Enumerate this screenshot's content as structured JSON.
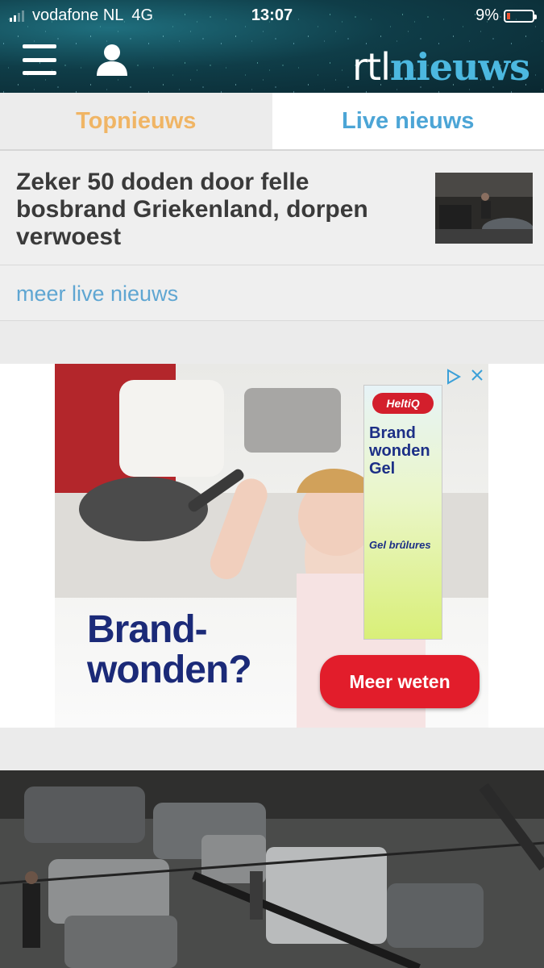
{
  "status_bar": {
    "carrier": "vodafone NL",
    "network": "4G",
    "time": "13:07",
    "battery": "9%"
  },
  "header": {
    "logo_part1": "rtl",
    "logo_part2": "nieuws"
  },
  "tabs": [
    {
      "label": "Topnieuws",
      "color": "#f0b565",
      "active": false
    },
    {
      "label": "Live nieuws",
      "color": "#4ca5d6",
      "active": true
    }
  ],
  "live_article": {
    "title": "Zeker 50 doden door felle bosbrand Griekenland, dorpen verwoest"
  },
  "more_link": "meer live nieuws",
  "ad": {
    "headline_line1": "Brand-",
    "headline_line2": "wonden?",
    "cta": "Meer weten",
    "brand": "HeltiQ",
    "product_line1": "Brand",
    "product_line2": "wonden",
    "product_line3": "Gel",
    "product_sub": "Gel brûlures",
    "accent_color": "#e21d2b",
    "text_color": "#1b2a78"
  }
}
